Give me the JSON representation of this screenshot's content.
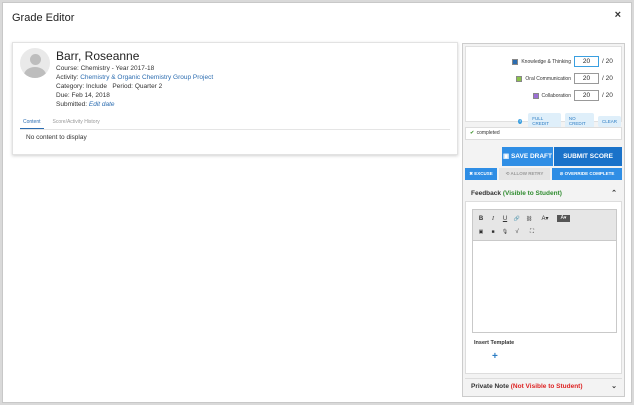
{
  "modal": {
    "title": "Grade Editor",
    "close": "×"
  },
  "student": {
    "name": "Barr, Roseanne",
    "course_label": "Course:",
    "course": "Chemistry - Year 2017-18",
    "activity_label": "Activity:",
    "activity": "Chemistry & Organic Chemistry Group Project",
    "category_label": "Category:",
    "category": "Include",
    "period_label": "Period:",
    "period": "Quarter 2",
    "due_label": "Due:",
    "due": "Feb 14, 2018",
    "submitted_label": "Submitted:",
    "submitted": "Edit date"
  },
  "tabs": [
    {
      "label": "Content"
    },
    {
      "label": "Score/Activity History"
    }
  ],
  "content": {
    "empty": "No content to display"
  },
  "criteria": [
    {
      "name": "Knowledge & Thinking",
      "value": "20",
      "max": "/ 20",
      "color": "#2b6cb0"
    },
    {
      "name": "Oral Communication",
      "value": "20",
      "max": "/ 20",
      "color": "#8bc34a"
    },
    {
      "name": "Collaboration",
      "value": "20",
      "max": "/ 20",
      "color": "#9c6fd6"
    }
  ],
  "credit": {
    "info": "i",
    "full": "FULL CREDIT",
    "none": "NO CREDIT",
    "clear": "CLEAR"
  },
  "status": {
    "check": "✔",
    "text": "completed"
  },
  "actions": {
    "save_draft": "SAVE DRAFT",
    "submit": "SUBMIT SCORE",
    "excuse": "✖ EXCUSE",
    "allow_retry": "⟲ ALLOW RETRY",
    "override": "⊘ OVERRIDE COMPLETE"
  },
  "feedback": {
    "title": "Feedback",
    "visibility": "(Visible to Student)",
    "chevron": "⌃",
    "insert_template": "Insert Template",
    "add": "+"
  },
  "toolbar": {
    "bold": "B",
    "italic": "I",
    "underline": "U",
    "link": "🔗",
    "unlink": "⛓",
    "text_color": "A▾",
    "bg_color": "A▾",
    "image": "▣",
    "video": "■",
    "mic": "🎙",
    "math": "√",
    "fullscreen": "⛶"
  },
  "private_note": {
    "title": "Private Note",
    "visibility": "(Not Visible to Student)",
    "chevron": "⌄"
  },
  "colors": {
    "accent": "#2f8ee5",
    "primary": "#1a72c9",
    "visible_green": "#2e8b2e",
    "hidden_red": "#dd2222"
  }
}
